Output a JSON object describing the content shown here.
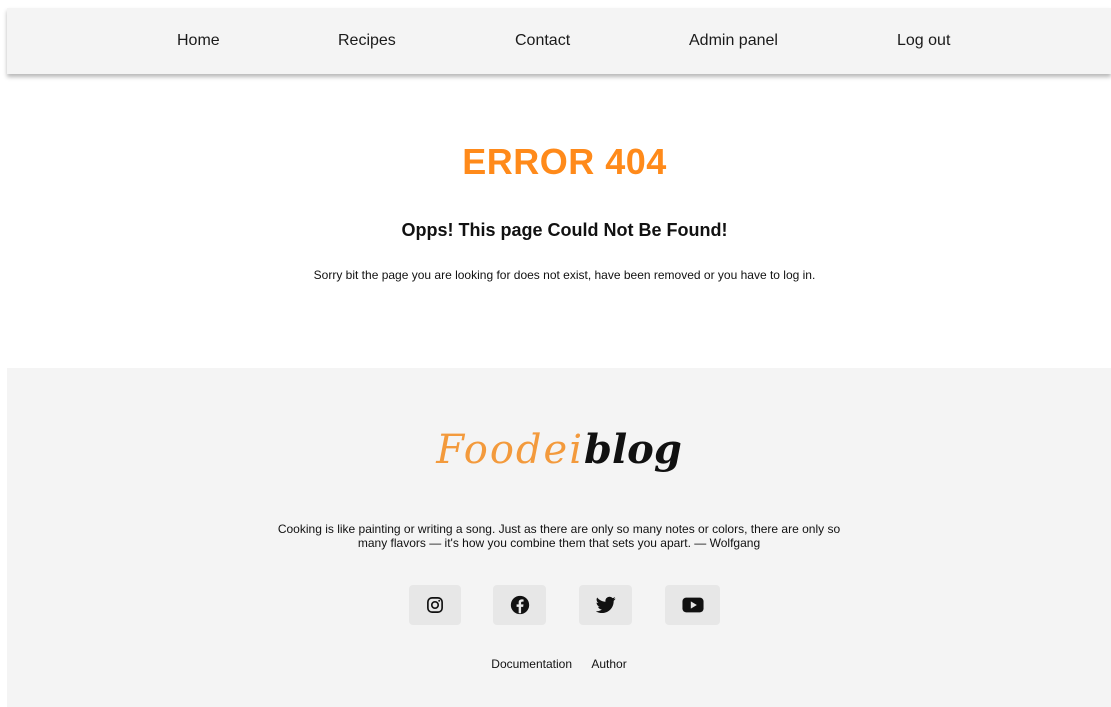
{
  "nav": {
    "items": [
      {
        "label": "Home"
      },
      {
        "label": "Recipes"
      },
      {
        "label": "Contact"
      },
      {
        "label": "Admin panel"
      },
      {
        "label": "Log out"
      }
    ]
  },
  "error": {
    "title": "ERROR 404",
    "subtitle": "Opps! This page Could Not Be Found!",
    "message": "Sorry bit the page you are looking for does not exist, have been removed or you have to log in."
  },
  "footer": {
    "logo": {
      "part1": "Foodei",
      "part2": "blog"
    },
    "quote": "Cooking is like painting or writing a song. Just as there are only so many notes or colors, there are only so many flavors — it's how you combine them that sets you apart. — Wolfgang",
    "social": [
      {
        "icon": "instagram-icon"
      },
      {
        "icon": "facebook-icon"
      },
      {
        "icon": "twitter-icon"
      },
      {
        "icon": "youtube-icon"
      }
    ],
    "links": [
      {
        "label": "Documentation"
      },
      {
        "label": "Author"
      }
    ]
  },
  "colors": {
    "accent": "#ff8a1a",
    "logo_orange": "#f39a3c",
    "nav_bg": "#f4f4f4",
    "footer_bg": "#f4f4f4",
    "social_button_bg": "#e7e7e7"
  }
}
